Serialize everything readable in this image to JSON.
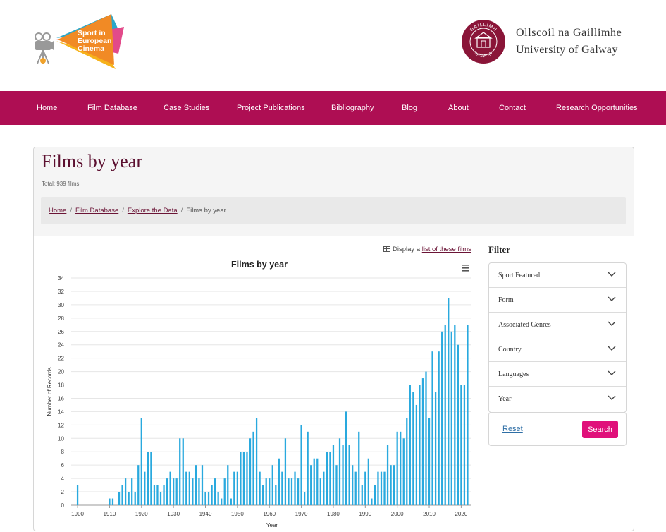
{
  "logo_sec": {
    "lines": [
      "Sport in",
      "European",
      "Cinema"
    ]
  },
  "logo_uni": {
    "line1": "Ollscoil na Gaillimhe",
    "line2": "University of Galway",
    "seal_top": "GAILLIMH",
    "seal_bottom": "GALWAY"
  },
  "colors": {
    "nav": "#ae0e53",
    "accent": "#e0107a",
    "bar": "#29a9de",
    "title": "#5c1030"
  },
  "nav": {
    "items": [
      "Home",
      "Film Database",
      "Case Studies",
      "Project Publications",
      "Bibliography",
      "Blog",
      "About",
      "Contact",
      "Research Opportunities"
    ]
  },
  "page": {
    "title": "Films by year",
    "total": "Total: 939 films",
    "breadcrumb": [
      "Home",
      "Film Database",
      "Explore the Data",
      "Films by year"
    ]
  },
  "display_list": {
    "prefix": "Display a",
    "link": "list of these films"
  },
  "chart_data": {
    "type": "bar",
    "title": "Films by year",
    "xlabel": "Year",
    "ylabel": "Number of Records",
    "xlim": [
      1898,
      2023
    ],
    "ylim": [
      0,
      34
    ],
    "yticks": [
      0,
      2,
      4,
      6,
      8,
      10,
      12,
      14,
      16,
      18,
      20,
      22,
      24,
      26,
      28,
      30,
      32,
      34
    ],
    "xticks": [
      1900,
      1910,
      1920,
      1930,
      1940,
      1950,
      1960,
      1970,
      1980,
      1990,
      2000,
      2010,
      2020
    ],
    "x": [
      1900,
      1910,
      1911,
      1913,
      1914,
      1915,
      1916,
      1917,
      1918,
      1919,
      1920,
      1921,
      1922,
      1923,
      1924,
      1925,
      1926,
      1927,
      1928,
      1929,
      1930,
      1931,
      1932,
      1933,
      1934,
      1935,
      1936,
      1937,
      1938,
      1939,
      1940,
      1941,
      1942,
      1943,
      1944,
      1945,
      1946,
      1947,
      1948,
      1949,
      1950,
      1951,
      1952,
      1953,
      1954,
      1955,
      1956,
      1957,
      1958,
      1959,
      1960,
      1961,
      1962,
      1963,
      1964,
      1965,
      1966,
      1967,
      1968,
      1969,
      1970,
      1971,
      1972,
      1973,
      1974,
      1975,
      1976,
      1977,
      1978,
      1979,
      1980,
      1981,
      1982,
      1983,
      1984,
      1985,
      1986,
      1987,
      1988,
      1989,
      1990,
      1991,
      1992,
      1993,
      1994,
      1995,
      1996,
      1997,
      1998,
      1999,
      2000,
      2001,
      2002,
      2003,
      2004,
      2005,
      2006,
      2007,
      2008,
      2009,
      2010,
      2011,
      2012,
      2013,
      2014,
      2015,
      2016,
      2017,
      2018,
      2019,
      2020,
      2021,
      2022
    ],
    "values": [
      3,
      1,
      1,
      2,
      3,
      4,
      2,
      4,
      2,
      6,
      13,
      5,
      8,
      8,
      3,
      3,
      2,
      3,
      4,
      5,
      4,
      4,
      10,
      10,
      5,
      5,
      4,
      6,
      4,
      6,
      2,
      2,
      3,
      4,
      2,
      1,
      4,
      6,
      1,
      5,
      5,
      8,
      8,
      8,
      10,
      11,
      13,
      5,
      3,
      4,
      4,
      6,
      3,
      7,
      5,
      10,
      4,
      4,
      5,
      4,
      12,
      2,
      11,
      6,
      7,
      7,
      4,
      5,
      8,
      8,
      9,
      6,
      10,
      9,
      14,
      9,
      6,
      5,
      11,
      3,
      5,
      7,
      1,
      3,
      5,
      5,
      5,
      9,
      6,
      6,
      11,
      11,
      10,
      13,
      18,
      17,
      15,
      18,
      19,
      20,
      13,
      23,
      17,
      23,
      26,
      27,
      31,
      26,
      27,
      24,
      18,
      18,
      27
    ]
  },
  "filter": {
    "title": "Filter",
    "items": [
      "Sport Featured",
      "Form",
      "Associated Genres",
      "Country",
      "Languages",
      "Year"
    ],
    "reset_label": "Reset",
    "search_label": "Search"
  }
}
